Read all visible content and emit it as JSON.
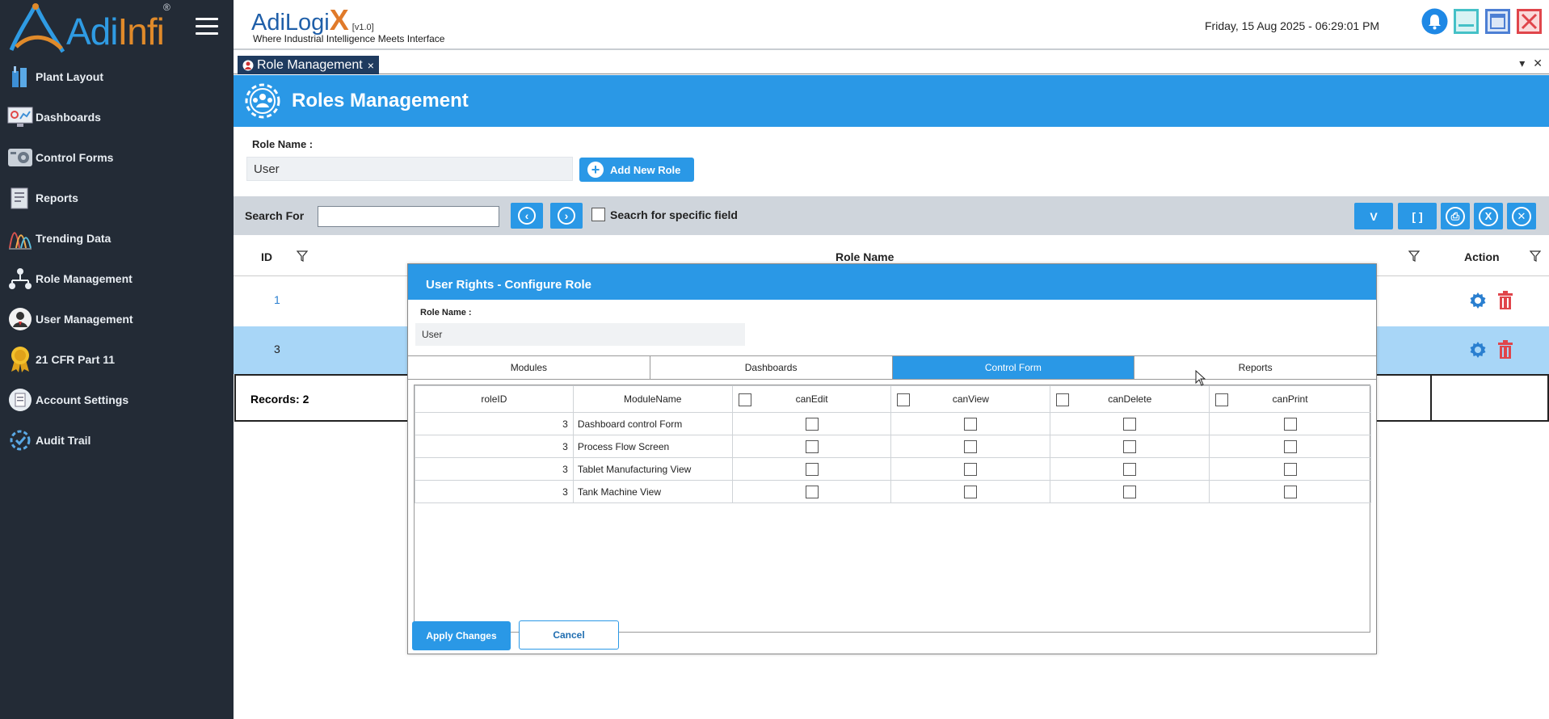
{
  "sidebar": {
    "logo_text_a": "Adi",
    "logo_text_b": "Infi",
    "logo_reg": "®",
    "items": [
      {
        "label": "Plant Layout",
        "icon": "plant-layout-icon"
      },
      {
        "label": "Dashboards",
        "icon": "dashboards-icon"
      },
      {
        "label": "Control Forms",
        "icon": "control-forms-icon"
      },
      {
        "label": "Reports",
        "icon": "reports-icon"
      },
      {
        "label": "Trending Data",
        "icon": "trending-data-icon"
      },
      {
        "label": "Role Management",
        "icon": "role-management-icon"
      },
      {
        "label": "User Management",
        "icon": "user-management-icon"
      },
      {
        "label": "21 CFR Part 11",
        "icon": "cfr-badge-icon"
      },
      {
        "label": "Account Settings",
        "icon": "account-settings-icon"
      },
      {
        "label": "Audit Trail",
        "icon": "audit-trail-icon"
      }
    ]
  },
  "topbar": {
    "brand_name": "AdiLogi",
    "brand_x": "X",
    "version": "[v1.0]",
    "tagline": "Where Industrial Intelligence Meets Interface",
    "datetime": "Friday, 15 Aug 2025 - 06:29:01 PM"
  },
  "tab": {
    "label": "Role Management",
    "close": "×"
  },
  "page": {
    "title": "Roles Management",
    "role_name_label": "Role Name :",
    "role_name_value": "User",
    "add_role_label": "Add New Role"
  },
  "search": {
    "label": "Search For",
    "value": "",
    "specific_field_label": "Seacrh for specific field",
    "btn_v": "V",
    "btn_brackets": "[ ]"
  },
  "grid": {
    "columns": {
      "id": "ID",
      "role_name": "Role Name",
      "action": "Action"
    },
    "rows": [
      {
        "id": "1"
      },
      {
        "id": "3"
      }
    ],
    "records_label": "Records: 2"
  },
  "modal": {
    "title": "User Rights - Configure Role",
    "role_name_label": "Role Name :",
    "role_name_value": "User",
    "tabs": [
      "Modules",
      "Dashboards",
      "Control Form",
      "Reports"
    ],
    "active_tab": "Control Form",
    "columns": [
      "roleID",
      "ModuleName",
      "canEdit",
      "canView",
      "canDelete",
      "canPrint"
    ],
    "rows": [
      {
        "roleID": "3",
        "ModuleName": "Dashboard control Form"
      },
      {
        "roleID": "3",
        "ModuleName": "Process Flow Screen"
      },
      {
        "roleID": "3",
        "ModuleName": "Tablet Manufacturing View"
      },
      {
        "roleID": "3",
        "ModuleName": "Tank Machine View"
      }
    ],
    "apply_label": "Apply Changes",
    "cancel_label": "Cancel"
  },
  "colors": {
    "accent": "#2a98e6",
    "sidebar_bg": "#232b36",
    "selected_row": "#a8d6f7",
    "delete_red": "#e0454b"
  }
}
